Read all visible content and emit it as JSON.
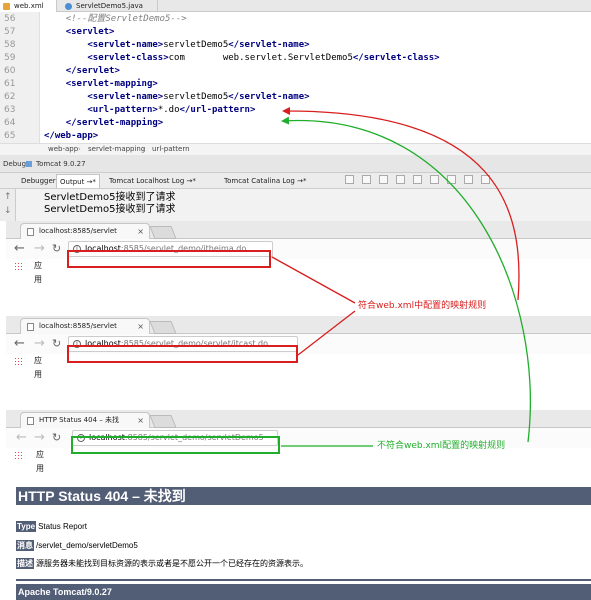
{
  "editor": {
    "tabs": [
      {
        "label": "web.xml",
        "active": true
      },
      {
        "label": "ServletDemo5.java",
        "active": false
      }
    ],
    "lines": [
      {
        "num": "56",
        "indent": "    ",
        "parts": [
          {
            "t": "cmt",
            "v": "<!--配置ServletDemo5-->"
          }
        ]
      },
      {
        "num": "57",
        "indent": "    ",
        "parts": [
          {
            "t": "tag",
            "v": "<servlet>"
          }
        ]
      },
      {
        "num": "58",
        "indent": "        ",
        "parts": [
          {
            "t": "tag",
            "v": "<servlet-name>"
          },
          {
            "t": "txt",
            "v": "servletDemo5"
          },
          {
            "t": "tag",
            "v": "</servlet-name>"
          }
        ]
      },
      {
        "num": "59",
        "indent": "        ",
        "parts": [
          {
            "t": "tag",
            "v": "<servlet-class>"
          },
          {
            "t": "txt",
            "v": "com       web.servlet.ServletDemo5"
          },
          {
            "t": "tag",
            "v": "</servlet-class>"
          }
        ]
      },
      {
        "num": "60",
        "indent": "    ",
        "parts": [
          {
            "t": "tag",
            "v": "</servlet>"
          }
        ]
      },
      {
        "num": "61",
        "indent": "    ",
        "parts": [
          {
            "t": "tag",
            "v": "<servlet-mapping>"
          }
        ]
      },
      {
        "num": "62",
        "indent": "        ",
        "parts": [
          {
            "t": "tag",
            "v": "<servlet-name>"
          },
          {
            "t": "txt",
            "v": "servletDemo5"
          },
          {
            "t": "tag",
            "v": "</servlet-name>"
          }
        ]
      },
      {
        "num": "63",
        "indent": "        ",
        "parts": [
          {
            "t": "tag",
            "v": "<url-pattern>"
          },
          {
            "t": "txt",
            "v": "*.do"
          },
          {
            "t": "tag",
            "v": "</url-pattern>"
          }
        ]
      },
      {
        "num": "64",
        "indent": "    ",
        "parts": [
          {
            "t": "tag",
            "v": "</servlet-mapping>"
          }
        ]
      },
      {
        "num": "65",
        "indent": "",
        "parts": [
          {
            "t": "tag",
            "v": "</web-app>"
          }
        ]
      }
    ],
    "breadcrumb": [
      "web-app",
      "servlet-mapping",
      "url-pattern"
    ]
  },
  "debug": {
    "title": "Debug",
    "config": "Tomcat 9.0.27",
    "tabs": [
      "Debugger",
      "Output →*",
      "Tomcat Localhost Log →*",
      "Tomcat Catalina Log →*"
    ],
    "output": [
      "ServletDemo5接收到了请求",
      "ServletDemo5接收到了请求"
    ]
  },
  "browsers": [
    {
      "tab": "localhost:8585/servlet",
      "url_host": "localhost",
      "url_path": ":8585/servlet_demo/itheima.do",
      "bookmarks": "应用"
    },
    {
      "tab": "localhost:8585/servlet",
      "url_host": "localhost",
      "url_path": ":8585/servlet_demo/servlet/itcast.do",
      "bookmarks": "应用"
    },
    {
      "tab": "HTTP Status 404 – 未找",
      "url_host": "localhost",
      "url_path": ":8585/servlet_demo/servletDemo5",
      "bookmarks": "应用"
    }
  ],
  "error_page": {
    "title": "HTTP Status 404 – 未找到",
    "type_key": "Type",
    "type_val": "Status Report",
    "msg_key": "消息",
    "msg_val": "/servlet_demo/servletDemo5",
    "desc_key": "描述",
    "desc_val": "源服务器未能找到目标资源的表示或者是不愿公开一个已经存在的资源表示。",
    "footer": "Apache Tomcat/9.0.27"
  },
  "annotations": {
    "match": "符合web.xml中配置的映射规则",
    "nomatch": "不符合web.xml配置的映射规则",
    "red": "#d81e1e",
    "green": "#1fae2b"
  }
}
